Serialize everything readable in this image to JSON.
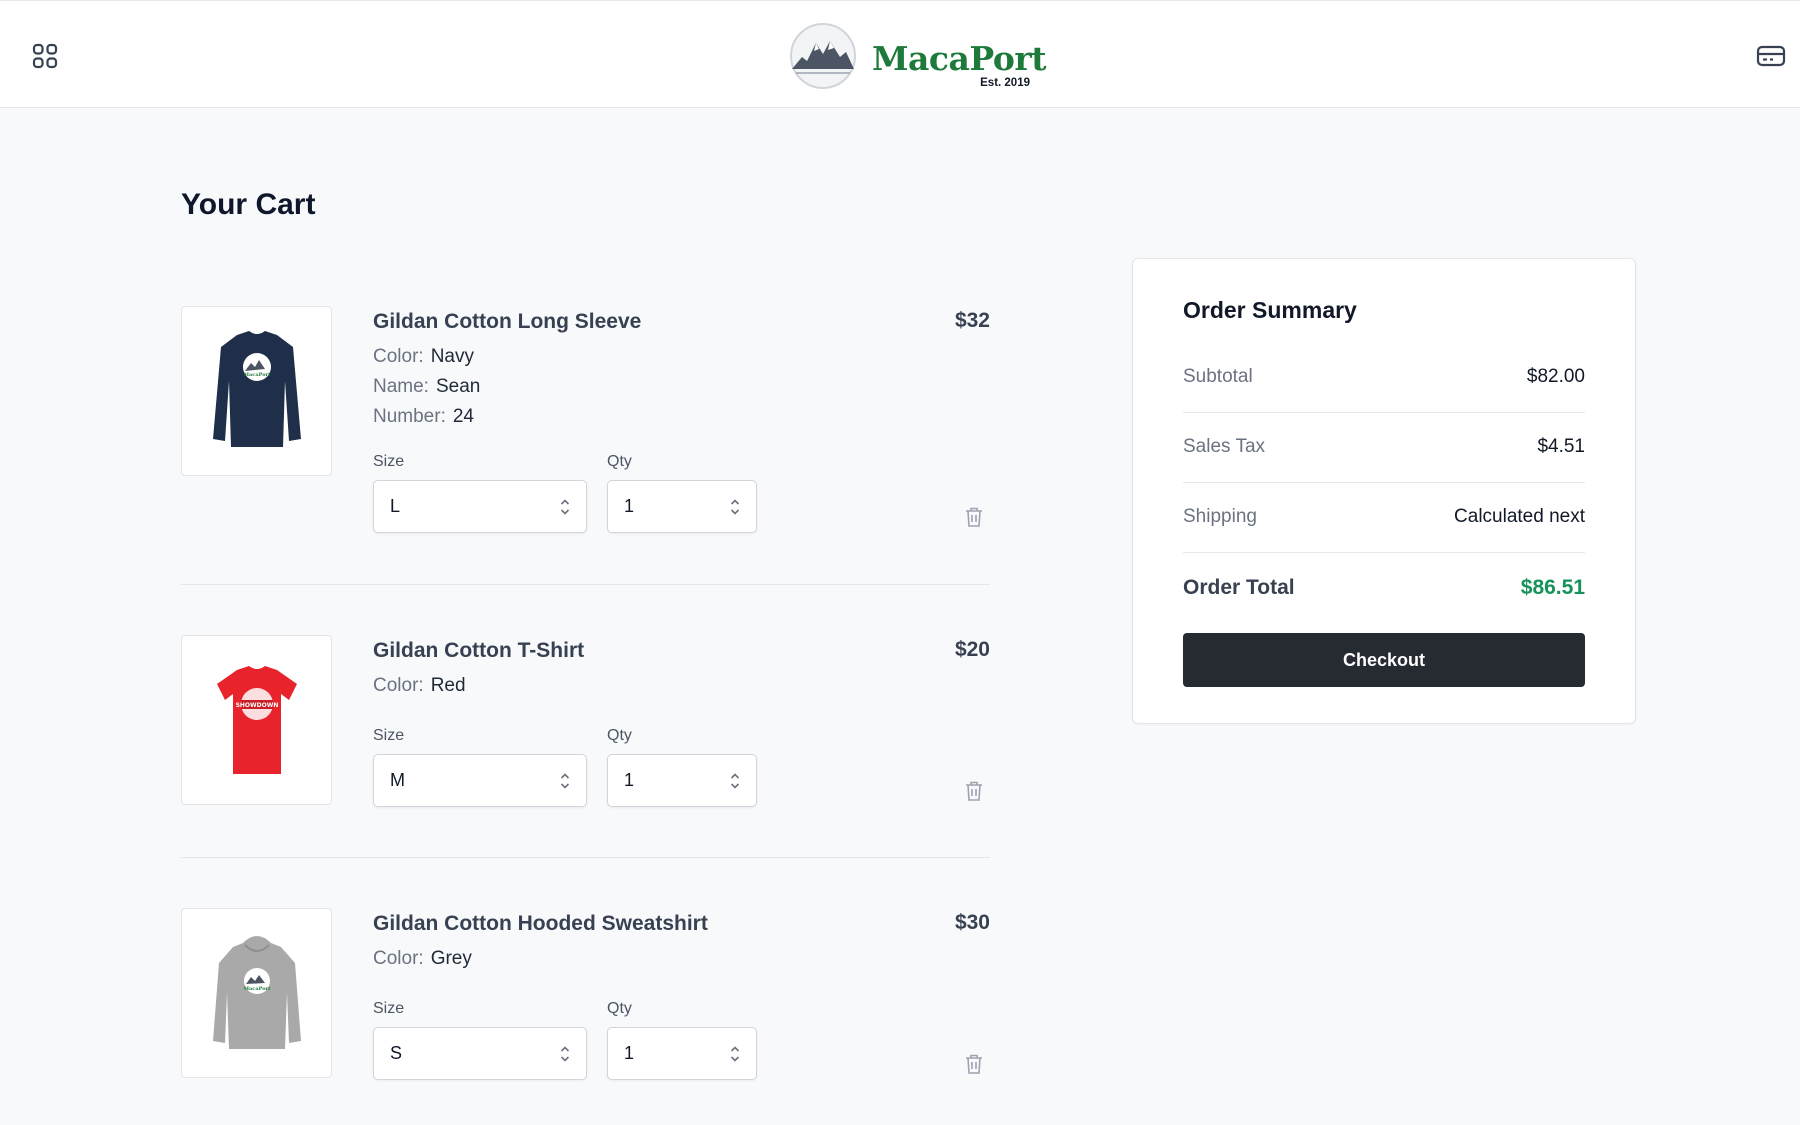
{
  "header": {
    "brand_name": "MacaPort",
    "brand_est": "Est. 2019",
    "menu_icon": "grid-menu-icon",
    "cart_icon": "card-icon"
  },
  "page": {
    "title": "Your Cart"
  },
  "labels": {
    "size": "Size",
    "qty": "Qty"
  },
  "items": [
    {
      "name": "Gildan Cotton Long Sleeve",
      "price": "$32",
      "attributes": [
        {
          "key": "Color:",
          "value": "Navy"
        },
        {
          "key": "Name:",
          "value": "Sean"
        },
        {
          "key": "Number:",
          "value": "24"
        }
      ],
      "size": "L",
      "qty": "1",
      "image_color": "#1f2f4a"
    },
    {
      "name": "Gildan Cotton T-Shirt",
      "price": "$20",
      "attributes": [
        {
          "key": "Color:",
          "value": "Red"
        }
      ],
      "size": "M",
      "qty": "1",
      "image_color": "#e8232b"
    },
    {
      "name": "Gildan Cotton Hooded Sweatshirt",
      "price": "$30",
      "attributes": [
        {
          "key": "Color:",
          "value": "Grey"
        }
      ],
      "size": "S",
      "qty": "1",
      "image_color": "#a9a9a9"
    }
  ],
  "summary": {
    "title": "Order Summary",
    "rows": [
      {
        "label": "Subtotal",
        "value": "$82.00"
      },
      {
        "label": "Sales Tax",
        "value": "$4.51"
      },
      {
        "label": "Shipping",
        "value": "Calculated next"
      },
      {
        "label": "Order Total",
        "value": "$86.51"
      }
    ],
    "checkout_label": "Checkout"
  },
  "colors": {
    "brand": "#1e7a3a",
    "total": "#16925a",
    "checkout_bg": "#262a31",
    "page_bg": "#f8f9fb"
  }
}
